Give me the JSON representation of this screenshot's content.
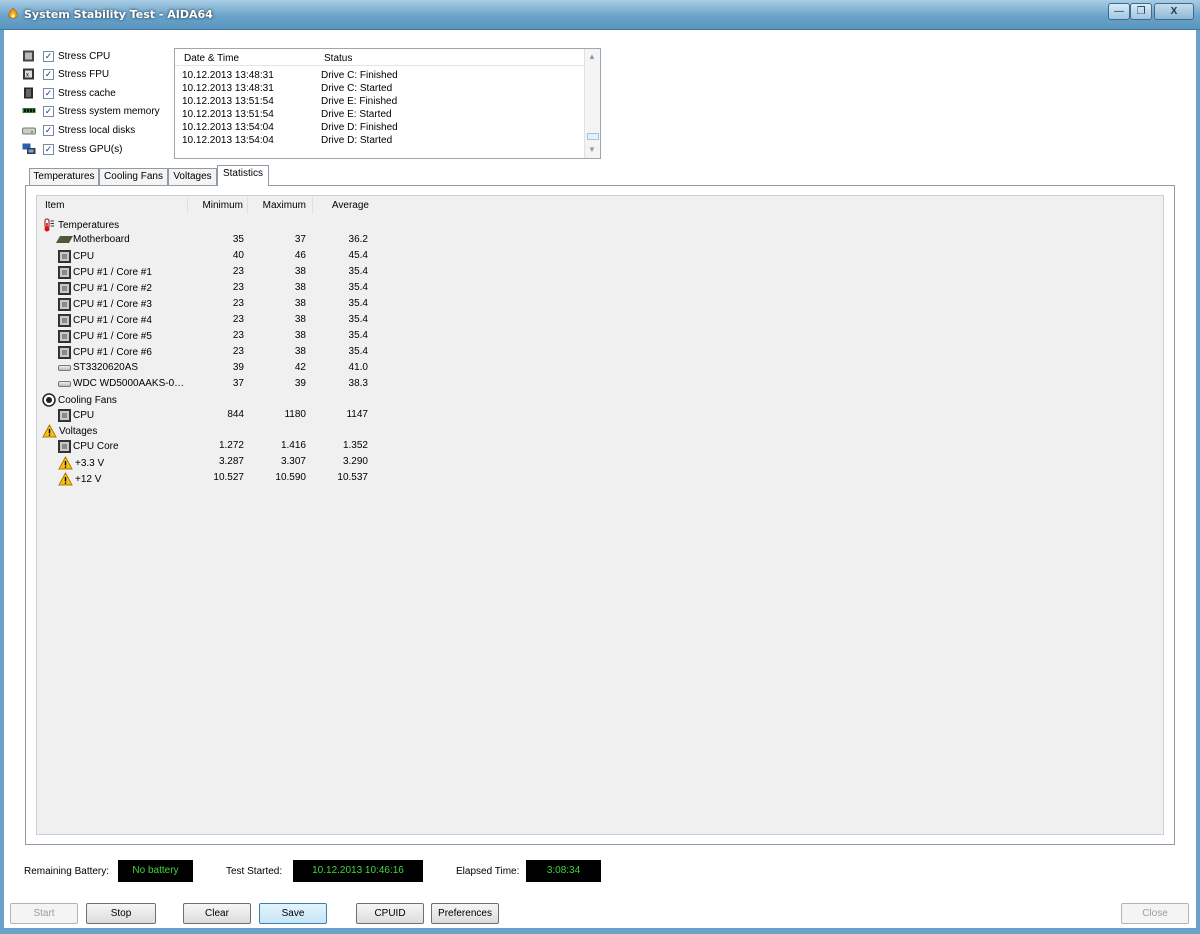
{
  "window": {
    "title": "System Stability Test - AIDA64"
  },
  "stress_options": [
    {
      "label": "Stress CPU",
      "checked": true,
      "icon": "cpu-icon"
    },
    {
      "label": "Stress FPU",
      "checked": true,
      "icon": "fpu-icon"
    },
    {
      "label": "Stress cache",
      "checked": true,
      "icon": "cache-icon"
    },
    {
      "label": "Stress system memory",
      "checked": true,
      "icon": "memory-icon"
    },
    {
      "label": "Stress local disks",
      "checked": true,
      "icon": "disk-icon"
    },
    {
      "label": "Stress GPU(s)",
      "checked": true,
      "icon": "gpu-icon"
    }
  ],
  "log": {
    "headers": {
      "date": "Date & Time",
      "status": "Status"
    },
    "rows": [
      {
        "date": "10.12.2013 13:48:31",
        "status": "Drive C: Finished"
      },
      {
        "date": "10.12.2013 13:48:31",
        "status": "Drive C: Started"
      },
      {
        "date": "10.12.2013 13:51:54",
        "status": "Drive E: Finished"
      },
      {
        "date": "10.12.2013 13:51:54",
        "status": "Drive E: Started"
      },
      {
        "date": "10.12.2013 13:54:04",
        "status": "Drive D: Finished"
      },
      {
        "date": "10.12.2013 13:54:04",
        "status": "Drive D: Started"
      }
    ]
  },
  "tabs": [
    "Temperatures",
    "Cooling Fans",
    "Voltages",
    "Statistics"
  ],
  "active_tab": "Statistics",
  "stats": {
    "headers": {
      "item": "Item",
      "min": "Minimum",
      "max": "Maximum",
      "avg": "Average"
    },
    "rows": [
      {
        "label": "Temperatures",
        "icon": "thermometer-icon",
        "group": true
      },
      {
        "label": "Motherboard",
        "icon": "motherboard-icon",
        "min": "35",
        "max": "37",
        "avg": "36.2"
      },
      {
        "label": "CPU",
        "icon": "cpu-icon",
        "min": "40",
        "max": "46",
        "avg": "45.4"
      },
      {
        "label": "CPU #1 / Core #1",
        "icon": "cpu-icon",
        "min": "23",
        "max": "38",
        "avg": "35.4"
      },
      {
        "label": "CPU #1 / Core #2",
        "icon": "cpu-icon",
        "min": "23",
        "max": "38",
        "avg": "35.4"
      },
      {
        "label": "CPU #1 / Core #3",
        "icon": "cpu-icon",
        "min": "23",
        "max": "38",
        "avg": "35.4"
      },
      {
        "label": "CPU #1 / Core #4",
        "icon": "cpu-icon",
        "min": "23",
        "max": "38",
        "avg": "35.4"
      },
      {
        "label": "CPU #1 / Core #5",
        "icon": "cpu-icon",
        "min": "23",
        "max": "38",
        "avg": "35.4"
      },
      {
        "label": "CPU #1 / Core #6",
        "icon": "cpu-icon",
        "min": "23",
        "max": "38",
        "avg": "35.4"
      },
      {
        "label": "ST3320620AS",
        "icon": "hard-disk-icon",
        "min": "39",
        "max": "42",
        "avg": "41.0"
      },
      {
        "label": "WDC WD5000AAKS-0…",
        "icon": "hard-disk-icon",
        "min": "37",
        "max": "39",
        "avg": "38.3"
      },
      {
        "label": "Cooling Fans",
        "icon": "fan-icon",
        "group": true
      },
      {
        "label": "CPU",
        "icon": "cpu-icon",
        "min": "844",
        "max": "1180",
        "avg": "1147"
      },
      {
        "label": "Voltages",
        "icon": "warning-icon",
        "group": true
      },
      {
        "label": "CPU Core",
        "icon": "cpu-icon",
        "min": "1.272",
        "max": "1.416",
        "avg": "1.352"
      },
      {
        "label": "+3.3 V",
        "icon": "warning-icon",
        "min": "3.287",
        "max": "3.307",
        "avg": "3.290"
      },
      {
        "label": "+12 V",
        "icon": "warning-icon",
        "min": "10.527",
        "max": "10.590",
        "avg": "10.537"
      }
    ]
  },
  "info": {
    "battery_label": "Remaining Battery:",
    "battery_value": "No battery",
    "started_label": "Test Started:",
    "started_value": "10.12.2013 10:46:16",
    "elapsed_label": "Elapsed Time:",
    "elapsed_value": "3:08:34"
  },
  "buttons": {
    "start": "Start",
    "stop": "Stop",
    "clear": "Clear",
    "save": "Save",
    "cpuid": "CPUID",
    "preferences": "Preferences",
    "close": "Close"
  },
  "colors": {
    "titlebar": "#6aa3c9",
    "lcd_text": "#3ed83e",
    "lcd_bg": "#000000"
  }
}
